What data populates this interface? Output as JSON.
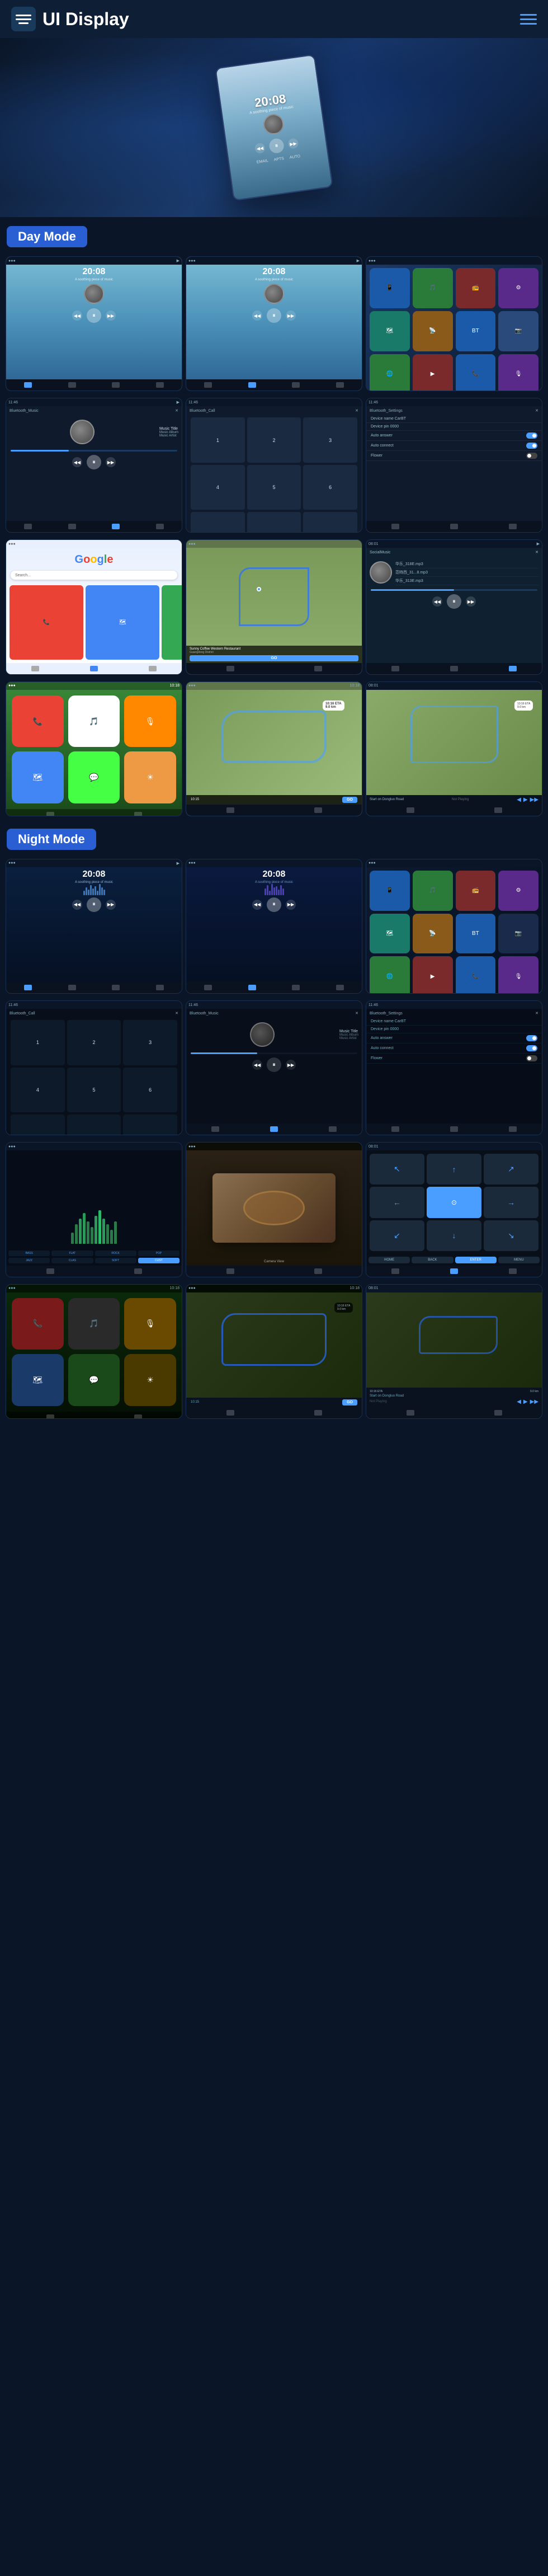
{
  "header": {
    "title": "UI Display",
    "menu_label": "menu"
  },
  "day_mode": {
    "label": "Day Mode"
  },
  "night_mode": {
    "label": "Night Mode"
  },
  "screens": {
    "time": "20:08",
    "music_title": "Music Title",
    "music_album": "Music Album",
    "music_artist": "Music Artist",
    "bt_music": "Bluetooth_Music",
    "bt_call": "Bluetooth_Call",
    "bt_settings": "Bluetooth_Settings",
    "device_name": "Device name  CarBT",
    "device_pin": "Device pin  0000",
    "auto_answer": "Auto answer",
    "auto_connect": "Auto connect",
    "flower": "Flower",
    "google_text": "Google",
    "social_music": "SocialMusic",
    "track1": "华乐_318E.mp3",
    "track2": "范特西_31...8.mp3",
    "track3": "华乐_313E.mp3",
    "restaurant_name": "Sunny Coffee Western Restaurant",
    "restaurant_addr": "Guangdong District",
    "eta_label": "10:16 ETA",
    "distance": "9.0 km",
    "go_label": "GO",
    "time_display": "10:15",
    "start_label": "Start on Dongluo Road",
    "not_playing": "Not Playing"
  },
  "colors": {
    "accent_blue": "#4a9eff",
    "day_badge": "#2a5fd4",
    "night_badge": "#2a5fd4",
    "bg_dark": "#0a1628",
    "screen_blue": "#1a3a6c"
  }
}
